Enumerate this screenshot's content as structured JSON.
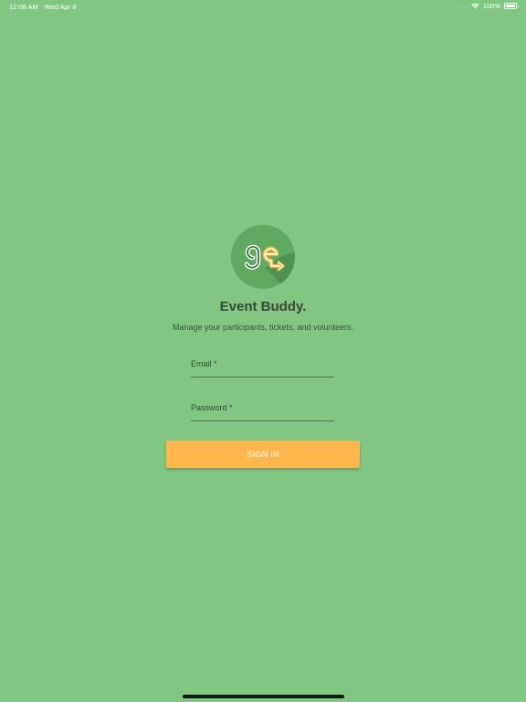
{
  "status_bar": {
    "time": "12:08 AM",
    "date": "Wed Apr 8",
    "battery_percent": "100%",
    "battery_level": 1.0,
    "icons": [
      "signal-dots-icon",
      "wifi-icon",
      "battery-icon"
    ],
    "signal_dots": "....."
  },
  "app": {
    "logo_icon": "event-buddy-logo-icon",
    "title": "Event Buddy.",
    "subtitle": "Manage your participants, tickets, and volunteers."
  },
  "form": {
    "email_label": "Email *",
    "email_value": "",
    "password_label": "Password *",
    "password_value": "",
    "sign_in_label": "SIGN IN"
  },
  "colors": {
    "background": "#81c784",
    "logo_circle": "#5daa60",
    "logo_shadow": "#4e944f",
    "logo_accent": "#f4b63c",
    "button": "#ffb74d",
    "text_dark": "#3a463a"
  }
}
